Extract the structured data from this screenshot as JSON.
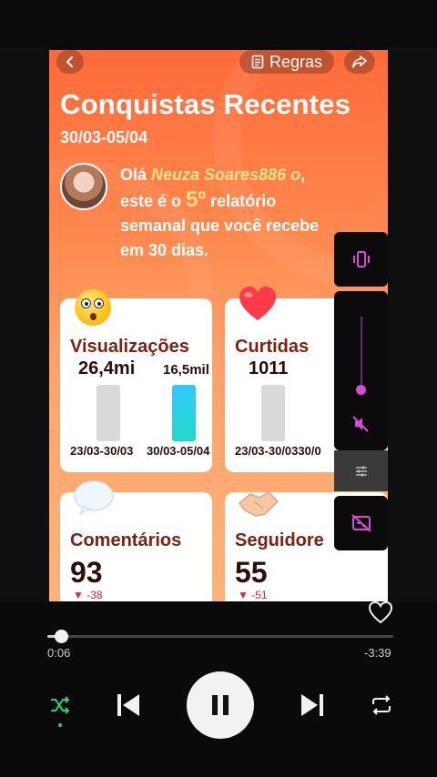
{
  "header": {
    "rules_label": "Regras"
  },
  "report": {
    "title": "Conquistas Recentes",
    "date_range": "30/03-05/04",
    "greeting_prefix": "Olá ",
    "username": "Neuza Soares886 o",
    "greeting_mid": ",",
    "line2_prefix": "este é o ",
    "report_number": "5º",
    "line2_suffix": " relatório",
    "line3": "semanal que você recebe",
    "line4": "em 30 dias."
  },
  "cards": {
    "views": {
      "label": "Visualizações",
      "value_prev": "26,4mi",
      "value_curr": "16,5mil",
      "xlabel_prev": "23/03-30/03",
      "xlabel_curr": "30/03-05/04",
      "emoji": "surprised-face-icon",
      "bars": [
        {
          "period": "23/03-30/03",
          "value": 26400000
        },
        {
          "period": "30/03-05/04",
          "value": 16500
        }
      ]
    },
    "likes": {
      "label": "Curtidas",
      "value_prev": "1011",
      "xlabel": "23/03-30/0330/0",
      "emoji": "heart-icon"
    },
    "comments": {
      "label": "Comentários",
      "value": "93",
      "delta": "-38",
      "emoji": "speech-bubble-icon"
    },
    "followers": {
      "label": "Seguidore",
      "value": "55",
      "delta": "-51",
      "emoji": "handshake-icon"
    }
  },
  "player": {
    "elapsed": "0:06",
    "remaining": "-3:39",
    "progress": 0.04,
    "shuffle_active": true,
    "state": "playing"
  },
  "colors": {
    "accent": "#d94ad9",
    "delta_negative": "#e22a2a",
    "card_label": "#7a2410",
    "highlight": "#ffe28a"
  }
}
